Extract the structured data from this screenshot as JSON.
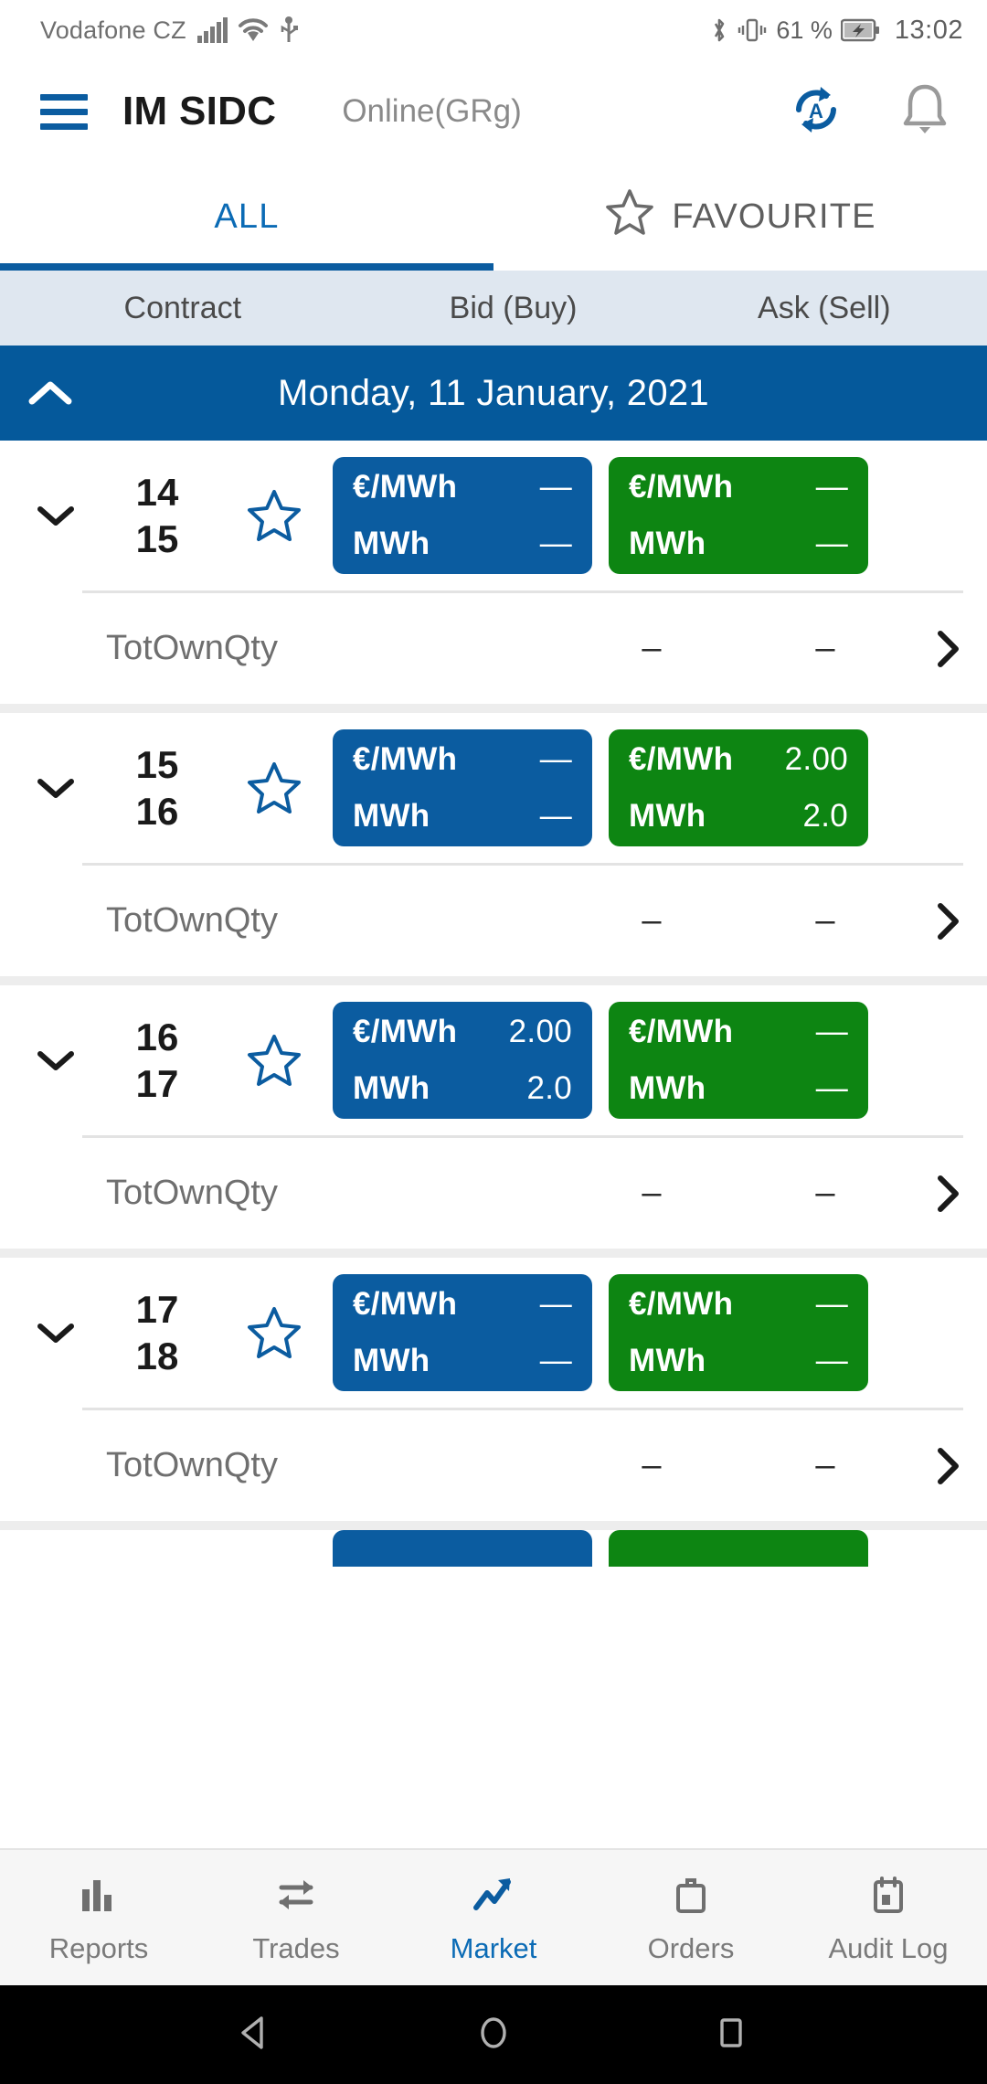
{
  "status_bar": {
    "carrier": "Vodafone CZ",
    "battery_percent": "61 %",
    "time": "13:02",
    "icons": [
      "signal-icon",
      "wifi-icon",
      "usb-icon",
      "bluetooth-icon",
      "vibrate-icon",
      "battery-charging-icon"
    ]
  },
  "app_bar": {
    "menu_icon": "hamburger-menu-icon",
    "title": "IM SIDC",
    "connection_status": "Online(GRg)",
    "refresh_icon": "auto-refresh-icon",
    "notification_icon": "bell-icon"
  },
  "tabs": {
    "items": [
      {
        "label": "ALL",
        "active": true,
        "icon": null
      },
      {
        "label": "FAVOURITE",
        "active": false,
        "icon": "star-outline-icon"
      }
    ]
  },
  "column_headers": {
    "contract": "Contract",
    "bid": "Bid (Buy)",
    "ask": "Ask (Sell)"
  },
  "date_header": {
    "label": "Monday, 11 January, 2021",
    "collapse_icon": "chevron-up-icon",
    "expanded": true
  },
  "contracts": [
    {
      "hour_from": "14",
      "hour_to": "15",
      "favourite": false,
      "bid": {
        "price_unit": "€/MWh",
        "price": "—",
        "qty_unit": "MWh",
        "qty": "—"
      },
      "ask": {
        "price_unit": "€/MWh",
        "price": "—",
        "qty_unit": "MWh",
        "qty": "—"
      },
      "sub": {
        "label": "TotOwnQty",
        "bid_value": "–",
        "ask_value": "–"
      }
    },
    {
      "hour_from": "15",
      "hour_to": "16",
      "favourite": false,
      "bid": {
        "price_unit": "€/MWh",
        "price": "—",
        "qty_unit": "MWh",
        "qty": "—"
      },
      "ask": {
        "price_unit": "€/MWh",
        "price": "2.00",
        "qty_unit": "MWh",
        "qty": "2.0"
      },
      "sub": {
        "label": "TotOwnQty",
        "bid_value": "–",
        "ask_value": "–"
      }
    },
    {
      "hour_from": "16",
      "hour_to": "17",
      "favourite": false,
      "bid": {
        "price_unit": "€/MWh",
        "price": "2.00",
        "qty_unit": "MWh",
        "qty": "2.0"
      },
      "ask": {
        "price_unit": "€/MWh",
        "price": "—",
        "qty_unit": "MWh",
        "qty": "—"
      },
      "sub": {
        "label": "TotOwnQty",
        "bid_value": "–",
        "ask_value": "–"
      }
    },
    {
      "hour_from": "17",
      "hour_to": "18",
      "favourite": false,
      "bid": {
        "price_unit": "€/MWh",
        "price": "—",
        "qty_unit": "MWh",
        "qty": "—"
      },
      "ask": {
        "price_unit": "€/MWh",
        "price": "—",
        "qty_unit": "MWh",
        "qty": "—"
      },
      "sub": {
        "label": "TotOwnQty",
        "bid_value": "–",
        "ask_value": "–"
      }
    }
  ],
  "bottom_nav": {
    "items": [
      {
        "label": "Reports",
        "icon": "bar-chart-icon",
        "active": false
      },
      {
        "label": "Trades",
        "icon": "exchange-arrows-icon",
        "active": false
      },
      {
        "label": "Market",
        "icon": "trending-up-icon",
        "active": true
      },
      {
        "label": "Orders",
        "icon": "briefcase-icon",
        "active": false
      },
      {
        "label": "Audit Log",
        "icon": "calendar-icon",
        "active": false
      }
    ]
  },
  "system_nav": {
    "back": "back-triangle-icon",
    "home": "home-circle-icon",
    "recents": "recents-square-icon"
  },
  "colors": {
    "brand_blue": "#0B5CA0",
    "accent_blue": "#0B6BB5",
    "bid_blue": "#0B5CA0",
    "ask_green": "#0D8512",
    "header_bg": "#dfe7f0",
    "date_bg": "#05599B"
  }
}
